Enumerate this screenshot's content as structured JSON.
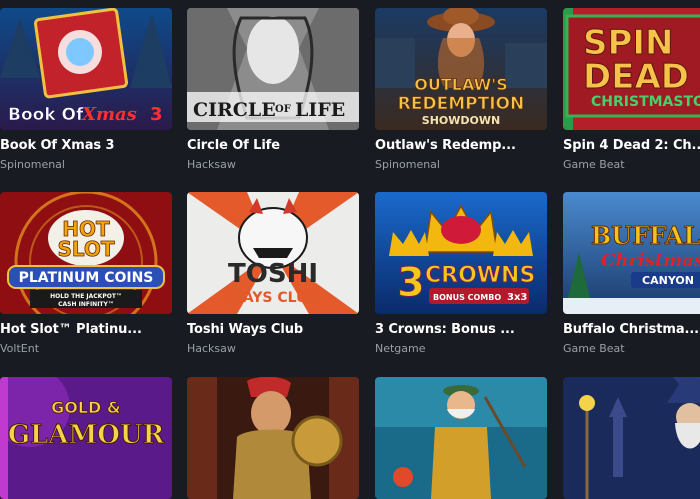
{
  "games": [
    {
      "title": "Book Of Xmas 3",
      "provider": "Spinomenal",
      "art_text": [
        "Book Of",
        "Xmas",
        "3"
      ],
      "icon": "book-xmas-art"
    },
    {
      "title": "Circle Of Life",
      "provider": "Hacksaw",
      "art_text": [
        "CIRCLE",
        "OF",
        "LIFE"
      ],
      "icon": "circle-of-life-art"
    },
    {
      "title": "Outlaw's Redemp...",
      "provider": "Spinomenal",
      "art_text": [
        "OUTLAW'S",
        "REDEMPTION",
        "SHOWDOWN"
      ],
      "icon": "cowgirl-art"
    },
    {
      "title": "Spin 4 Dead 2: Ch...",
      "provider": "Game Beat",
      "art_text": [
        "SPIN",
        "DEAD",
        "CHRISTMASTOWN"
      ],
      "icon": "spin-dead-art"
    },
    {
      "title": "Hot Slot™ Platinu...",
      "provider": "VoltEnt",
      "art_text": [
        "HOT",
        "SLOT",
        "PLATINUM COINS",
        "HOLD THE JACKPOT™",
        "CASH INFINITY™"
      ],
      "icon": "hot-slot-art"
    },
    {
      "title": "Toshi Ways Club",
      "provider": "Hacksaw",
      "art_text": [
        "TOSHI",
        "WAYS CLUB"
      ],
      "icon": "toshi-mask-art"
    },
    {
      "title": "3 Crowns: Bonus ...",
      "provider": "Netgame",
      "art_text": [
        "3",
        "CROWNS",
        "BONUS COMBO",
        "3x3"
      ],
      "icon": "crowns-art"
    },
    {
      "title": "Buffalo Christma...",
      "provider": "Game Beat",
      "art_text": [
        "BUFFALO",
        "Christmas",
        "CANYON"
      ],
      "icon": "buffalo-art"
    },
    {
      "title": "",
      "provider": "",
      "art_text": [
        "GOLD &",
        "GLAMOUR"
      ],
      "icon": "gold-glamour-art"
    },
    {
      "title": "",
      "provider": "",
      "art_text": [],
      "icon": "gladiator-art"
    },
    {
      "title": "",
      "provider": "",
      "art_text": [],
      "icon": "fisherman-art"
    },
    {
      "title": "",
      "provider": "",
      "art_text": [],
      "icon": "wizard-art"
    }
  ]
}
